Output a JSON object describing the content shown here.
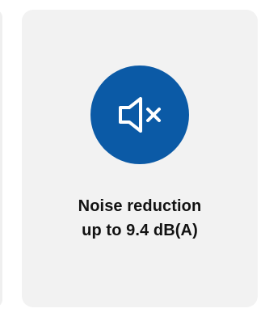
{
  "card": {
    "icon": "mute-speaker-icon",
    "line1": "Noise reduction",
    "line2": "up to 9.4 dB(A)"
  },
  "colors": {
    "accent": "#0b5aa6",
    "card_bg": "#f2f2f2",
    "text": "#121212"
  }
}
